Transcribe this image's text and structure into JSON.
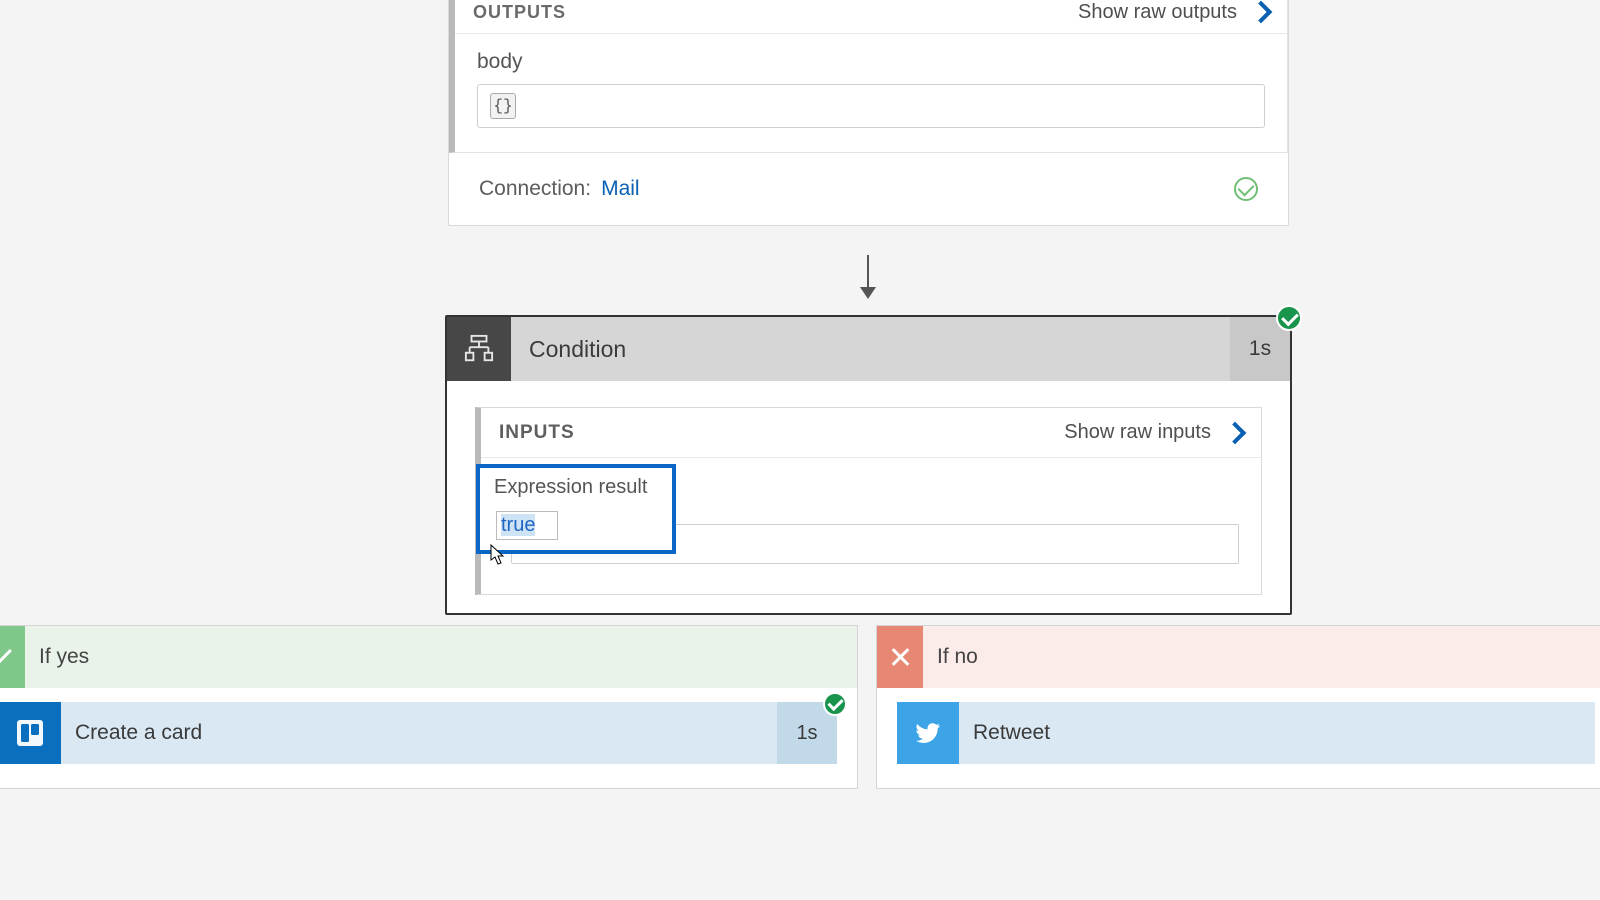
{
  "top_card": {
    "outputs_label": "OUTPUTS",
    "show_raw_outputs": "Show raw outputs",
    "body_label": "body",
    "body_value": "{}",
    "connection_label": "Connection:",
    "connection_name": "Mail"
  },
  "condition": {
    "title": "Condition",
    "duration": "1s",
    "inputs_label": "INPUTS",
    "show_raw_inputs": "Show raw inputs",
    "expression_label": "Expression result",
    "expression_value": "true"
  },
  "branches": {
    "yes": {
      "label": "If yes",
      "action": "Create a card",
      "duration": "1s"
    },
    "no": {
      "label": "If no",
      "action": "Retweet"
    }
  }
}
